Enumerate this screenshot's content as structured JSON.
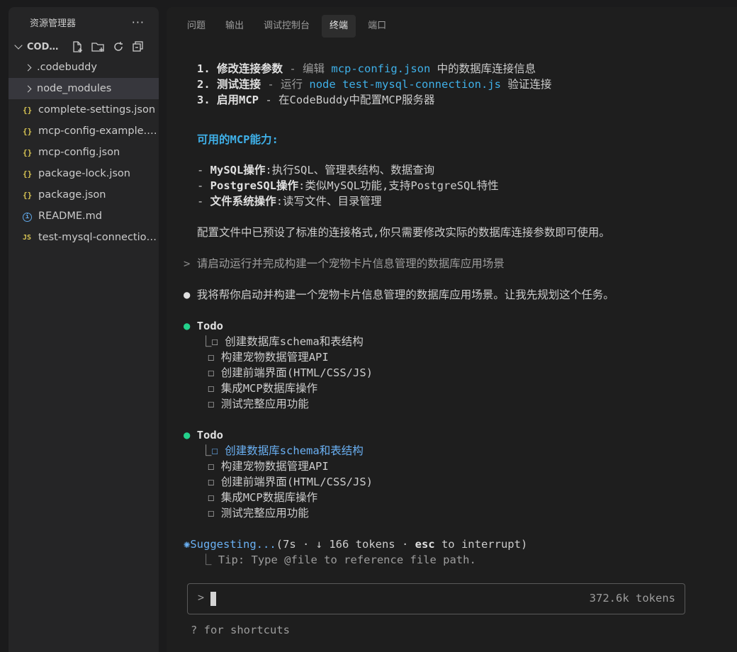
{
  "sidebar": {
    "title": "资源管理器",
    "more": "···",
    "folder": "CODE...",
    "items": [
      {
        "type": "dir",
        "label": ".codebuddy"
      },
      {
        "type": "dir",
        "label": "node_modules"
      },
      {
        "type": "json",
        "label": "complete-settings.json"
      },
      {
        "type": "json",
        "label": "mcp-config-example.json"
      },
      {
        "type": "json",
        "label": "mcp-config.json"
      },
      {
        "type": "json",
        "label": "package-lock.json"
      },
      {
        "type": "json",
        "label": "package.json"
      },
      {
        "type": "info",
        "label": "README.md"
      },
      {
        "type": "js",
        "label": "test-mysql-connection.js"
      }
    ],
    "json_icon": "{}",
    "js_icon": "JS",
    "info_icon": "i"
  },
  "tabs": [
    "问题",
    "输出",
    "调试控制台",
    "终端",
    "端口"
  ],
  "terminal": {
    "steps": [
      {
        "num": "1.",
        "title": "修改连接参数",
        "sep": " - 编辑 ",
        "code": "mcp-config.json",
        "rest": " 中的数据库连接信息"
      },
      {
        "num": "2.",
        "title": "测试连接",
        "sep": " - 运行 ",
        "code": "node test-mysql-connection.js",
        "rest": " 验证连接"
      },
      {
        "num": "3.",
        "title": "启用MCP",
        "sep": " - 在CodeBuddy中配置MCP服务器",
        "code": "",
        "rest": ""
      }
    ],
    "capabilities_heading": "可用的MCP能力:",
    "capabilities": [
      {
        "name": "MySQL操作",
        "desc": ":执行SQL、管理表结构、数据查询"
      },
      {
        "name": "PostgreSQL操作",
        "desc": ":类似MySQL功能,支持PostgreSQL特性"
      },
      {
        "name": "文件系统操作",
        "desc": ":读写文件、目录管理"
      }
    ],
    "summary": "配置文件中已预设了标准的连接格式,你只需要修改实际的数据库连接参数即可使用。",
    "user_prompt": "请启动运行并完成构建一个宠物卡片信息管理的数据库应用场景",
    "assistant": "我将帮你启动并构建一个宠物卡片信息管理的数据库应用场景。让我先规划这个任务。",
    "todo_label": "Todo",
    "todos": [
      "创建数据库schema和表结构",
      "构建宠物数据管理API",
      "创建前端界面(HTML/CSS/JS)",
      "集成MCP数据库操作",
      "测试完整应用功能"
    ],
    "suggesting": "Suggesting...",
    "suggest_meta": "(7s · ↓ 166 tokens · ",
    "esc": "esc",
    "interrupt": " to interrupt)",
    "tip": "Tip: Type @file to reference file path."
  },
  "input": {
    "caret": ">",
    "tokens": "372.6k tokens"
  },
  "shortcuts": "? for shortcuts"
}
